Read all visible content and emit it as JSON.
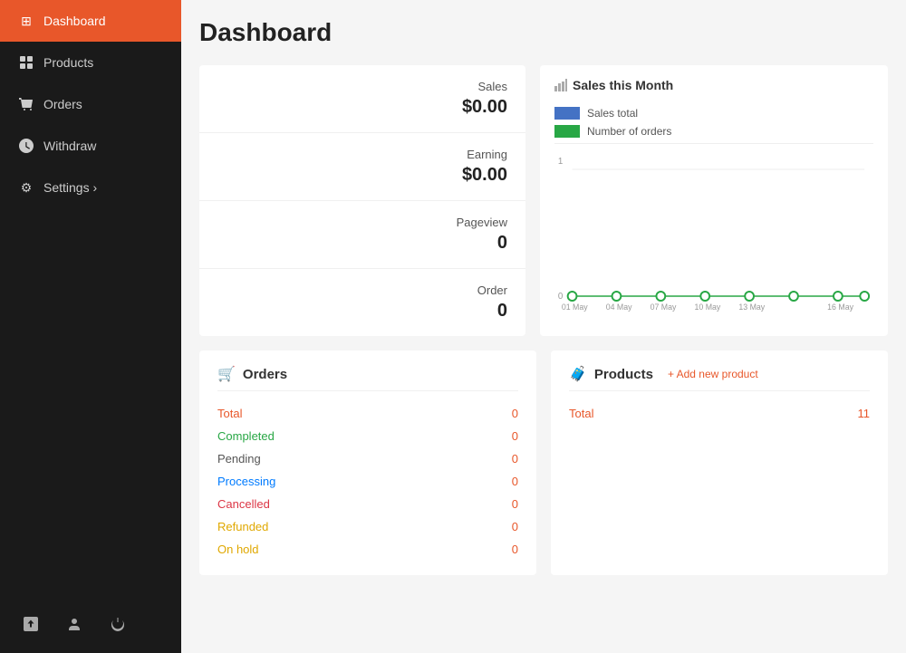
{
  "page": {
    "title": "Dashboard"
  },
  "sidebar": {
    "items": [
      {
        "id": "dashboard",
        "label": "Dashboard",
        "icon": "⊞",
        "active": true
      },
      {
        "id": "products",
        "label": "Products",
        "icon": "🧳",
        "active": false
      },
      {
        "id": "orders",
        "label": "Orders",
        "icon": "🛒",
        "active": false
      },
      {
        "id": "withdraw",
        "label": "Withdraw",
        "icon": "⬆",
        "active": false
      },
      {
        "id": "settings",
        "label": "Settings ›",
        "icon": "⚙",
        "active": false
      }
    ],
    "bottom_buttons": [
      {
        "id": "external",
        "icon": "↗"
      },
      {
        "id": "user",
        "icon": "👤"
      },
      {
        "id": "power",
        "icon": "⏻"
      }
    ]
  },
  "stats": {
    "sales_label": "Sales",
    "sales_value": "$0.00",
    "earning_label": "Earning",
    "earning_value": "$0.00",
    "pageview_label": "Pageview",
    "pageview_value": "0",
    "order_label": "Order",
    "order_value": "0"
  },
  "chart": {
    "title": "Sales this Month",
    "legend": [
      {
        "label": "Sales total",
        "color": "#4472c4"
      },
      {
        "label": "Number of orders",
        "color": "#28a745"
      }
    ],
    "x_labels": [
      "01 May",
      "04 May",
      "07 May",
      "10 May",
      "13 May",
      "16 May"
    ],
    "y_label": "1"
  },
  "orders": {
    "title": "Orders",
    "rows": [
      {
        "label": "Total",
        "value": "0",
        "class": "total"
      },
      {
        "label": "Completed",
        "value": "0",
        "class": "completed"
      },
      {
        "label": "Pending",
        "value": "0",
        "class": "pending"
      },
      {
        "label": "Processing",
        "value": "0",
        "class": "processing"
      },
      {
        "label": "Cancelled",
        "value": "0",
        "class": "cancelled"
      },
      {
        "label": "Refunded",
        "value": "0",
        "class": "refunded"
      },
      {
        "label": "On hold",
        "value": "0",
        "class": "onhold"
      }
    ]
  },
  "products": {
    "title": "Products",
    "add_label": "+ Add new product",
    "rows": [
      {
        "label": "Total",
        "value": "11",
        "class": "total"
      }
    ]
  }
}
